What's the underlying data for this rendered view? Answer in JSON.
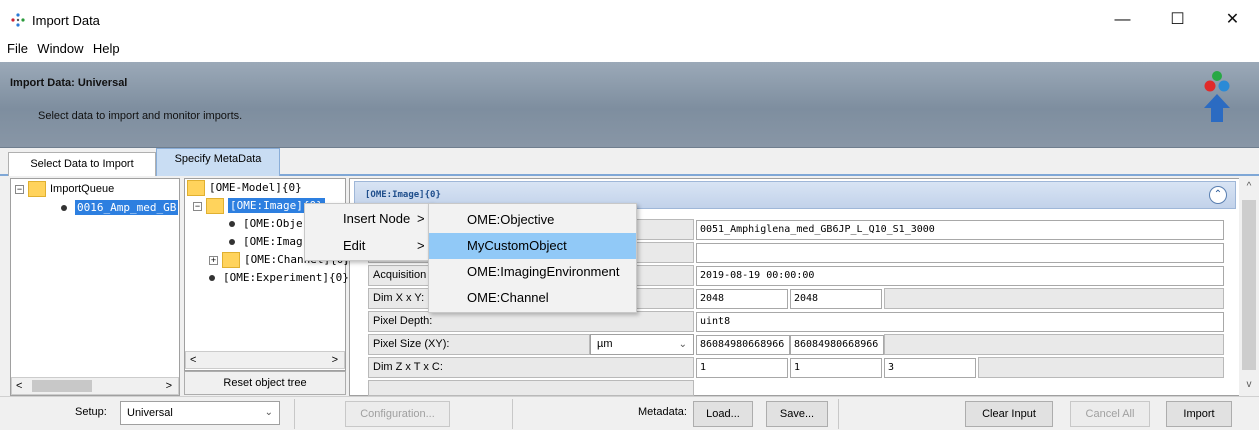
{
  "window": {
    "title": "Import Data",
    "minimize": "—",
    "maximize": "☐",
    "close": "✕"
  },
  "menu": [
    "File",
    "Window",
    "Help"
  ],
  "header": {
    "title": "Import Data: Universal",
    "subtitle": "Select data to import and monitor imports."
  },
  "tabs": [
    {
      "label": "Select Data to Import"
    },
    {
      "label": "Specify MetaData",
      "active": true
    }
  ],
  "queue_tree": {
    "root": "ImportQueue",
    "item": "0016_Amp_med_GB",
    "collapse_glyph": "−"
  },
  "ome_tree": {
    "rows": [
      {
        "label": "[OME-Model]{0}"
      },
      {
        "label": "[OME:Image]{0}"
      },
      {
        "label": "[OME:Obje"
      },
      {
        "label": "[OME:Imag"
      },
      {
        "label": "[OME:Channel]{0}"
      },
      {
        "label": "[OME:Experiment]{0}"
      }
    ],
    "collapse_glyph": "−",
    "expand_glyph": "+",
    "reset_button": "Reset object tree"
  },
  "scroll_arrows": {
    "left": "<",
    "right": ">",
    "up": "^",
    "down": "v"
  },
  "metadata_panel": {
    "header": "[OME:Image]{0}",
    "collapse_glyph": "⌃",
    "rows": [
      {
        "label": "",
        "value": "0051_Amphiglena_med_GB6JP_L_Q10_S1_3000"
      },
      {
        "label": "",
        "value": ""
      },
      {
        "label": "Acquisition T",
        "value": "2019-08-19 00:00:00"
      },
      {
        "label": "Dim X x Y:",
        "values": [
          "2048",
          "2048"
        ]
      },
      {
        "label": "Pixel Depth:",
        "value": "uint8"
      },
      {
        "label": "Pixel Size (XY):",
        "unit": "µm",
        "values": [
          "86084980668966",
          "86084980668966"
        ]
      },
      {
        "label": "Dim Z x T x C:",
        "values": [
          "1",
          "1",
          "3"
        ]
      }
    ]
  },
  "context_menu": {
    "items": [
      {
        "label": "Insert Node",
        "arrow": ">"
      },
      {
        "label": "Edit",
        "arrow": ">"
      }
    ],
    "submenu": [
      "OME:Objective",
      "MyCustomObject",
      "OME:ImagingEnvironment",
      "OME:Channel"
    ],
    "highlighted": "MyCustomObject",
    "highlight_color": "#91c9f7"
  },
  "bottom_bar": {
    "setup_label": "Setup:",
    "setup_value": "Universal",
    "configuration_button": "Configuration...",
    "metadata_label": "Metadata:",
    "load_button": "Load...",
    "save_button": "Save...",
    "clear_input_button": "Clear Input",
    "cancel_all_button": "Cancel All",
    "import_button": "Import"
  },
  "colors": {
    "selection": "#2d7fe0",
    "header_bg": "#8a98a8",
    "active_tab": "#c9ddf3"
  }
}
